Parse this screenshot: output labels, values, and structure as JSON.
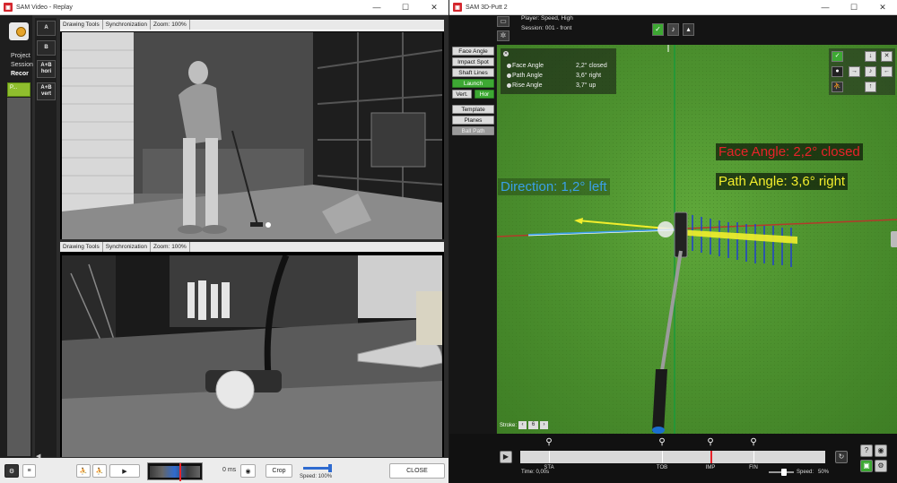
{
  "left_window": {
    "title": "SAM Video - Replay",
    "controls": [
      "—",
      "☐",
      "✕"
    ],
    "sidebar": {
      "project": "Project",
      "session": "Session",
      "recording": "Recor",
      "rec_tile": "P..."
    },
    "tools": [
      "A",
      "B",
      "A+B hori",
      "A+B vert"
    ],
    "top_video": {
      "toolbar": [
        "Drawing Tools",
        "Synchronization",
        "Zoom: 100%"
      ]
    },
    "bottom_video": {
      "toolbar": [
        "Drawing Tools",
        "Synchronization",
        "Zoom: 100%"
      ]
    },
    "bottom_bar": {
      "play_icon": "▶",
      "time": "0 ms",
      "crop": "Crop",
      "speed": "Speed: 100%",
      "close": "CLOSE"
    }
  },
  "right_window": {
    "title": "SAM 3D-Putt 2",
    "controls": [
      "—",
      "☐",
      "✕"
    ],
    "player": "Player: Speed, High",
    "session": "Session: 001 - front",
    "side_buttons": {
      "face_angle": "Face Angle",
      "impact_spot": "Impact Spot",
      "shaft_lines": "Shaft Lines",
      "launch": "Launch",
      "vert": "Vert.",
      "hor": "Hor",
      "template": "Template",
      "planes": "Planes",
      "ball_path": "Ball Path"
    },
    "data_panel": {
      "rows": [
        {
          "label": "Face Angle",
          "value": "2,2° closed"
        },
        {
          "label": "Path Angle",
          "value": "3,6° right"
        },
        {
          "label": "Rise Angle",
          "value": "3,7° up"
        }
      ]
    },
    "overlays": {
      "face_angle": "Face Angle: 2,2° closed",
      "path_angle": "Path Angle: 3,6° right",
      "direction": "Direction: 1,2° left"
    },
    "colors": {
      "face": "#e8232a",
      "path": "#f2ee2c",
      "direction": "#3aa0e8",
      "green_ok": "#3da833"
    },
    "stroke": {
      "label": "Stroke:",
      "value": "6"
    },
    "timeline": {
      "markers": [
        "STA",
        "TOB",
        "IMP",
        "FIN"
      ],
      "time": "Time:  0,00s",
      "speed": "Speed:",
      "speed_value": "50%"
    }
  }
}
